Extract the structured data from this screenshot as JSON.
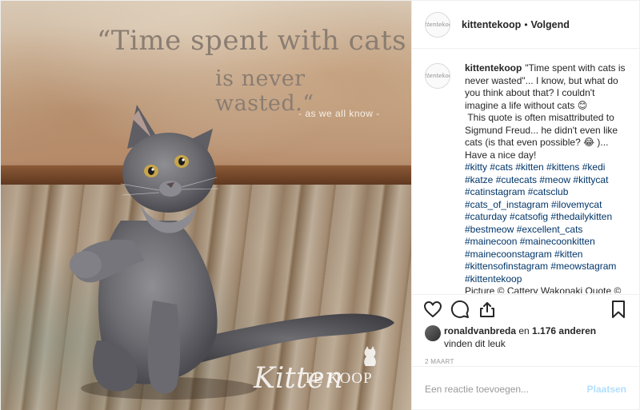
{
  "image": {
    "quote_line1": "“Time spent with cats",
    "quote_line2": "is never wasted.“",
    "quote_line3": "- as we all know -",
    "watermark_script": "Kitten",
    "watermark_text": "TE KOOP"
  },
  "header": {
    "avatar_text": "kittentekoop",
    "username": "kittentekoop",
    "separator": "•",
    "follow_status": "Volgend"
  },
  "caption": {
    "avatar_text": "kittentekoop",
    "username": "kittentekoop",
    "text": "\"Time spent with cats is never wasted\"... I know, but what do you think about that? I couldn't imagine a life without cats 😊\n This quote is often misattributed to Sigmund Freud... he didn't even like cats (is that even possible? 😂 )... Have a nice day!\n",
    "hashtags": "#kitty #cats #kitten #kittens #kedi #katze #cutecats #meow #kittycat #catinstagram #catsclub #cats_of_instagram #ilovemycat #caturday #catsofig #thedailykitten #bestmeow #excellent_cats #mainecoon #mainecoonkitten #mainecoonstagram #kitten #kittensofinstagram #meowstagram #kittentekoop",
    "credit": "Picture © Cattery Wakonaki Quote ©"
  },
  "actions": {
    "icons": [
      "heart-icon",
      "comment-icon",
      "share-icon",
      "bookmark-icon"
    ]
  },
  "likes": {
    "user": "ronaldvanbreda",
    "middle": " en ",
    "count": "1.176 anderen",
    "line2": "vinden dit leuk"
  },
  "date": "2 MAART",
  "comment": {
    "placeholder": "Een reactie toevoegen...",
    "post_label": "Plaatsen"
  },
  "colors": {
    "link": "#003569",
    "post_button_disabled": "#b2dffc",
    "border": "#efefef"
  }
}
